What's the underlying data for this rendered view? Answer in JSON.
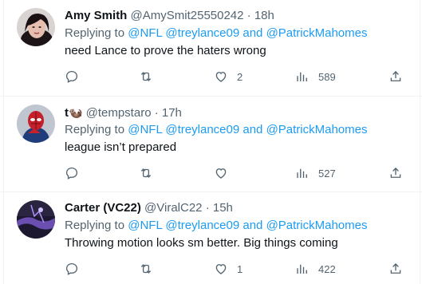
{
  "tweets": [
    {
      "name": "Amy Smith",
      "handle": "@AmySmit25550242",
      "dot": "·",
      "time": "18h",
      "replying_prefix": "Replying to",
      "mention_1": "@NFL",
      "mention_2": "@treylance09",
      "conjunction": "and",
      "mention_3": "@PatrickMahomes",
      "text": "need Lance to prove the haters wrong",
      "likes": "2",
      "views": "589"
    },
    {
      "name": "t",
      "name_emoji": "🦦",
      "handle": "@tempstaro",
      "dot": "·",
      "time": "17h",
      "replying_prefix": "Replying to",
      "mention_1": "@NFL",
      "mention_2": "@treylance09",
      "conjunction": "and",
      "mention_3": "@PatrickMahomes",
      "text": "league isn’t prepared",
      "likes": "",
      "views": "527"
    },
    {
      "name": "Carter (VC22)",
      "handle": "@ViralC22",
      "dot": "·",
      "time": "15h",
      "replying_prefix": "Replying to",
      "mention_1": "@NFL",
      "mention_2": "@treylance09",
      "conjunction": "and",
      "mention_3": "@PatrickMahomes",
      "text": "Throwing motion looks sm better. Big things coming",
      "likes": "1",
      "views": "422"
    }
  ],
  "colors": {
    "accent": "#1d9bf0",
    "secondary_text": "#536471",
    "primary_text": "#0f1419",
    "divider": "#eff3f4"
  },
  "icons": [
    "reply-icon",
    "retweet-icon",
    "like-icon",
    "views-icon",
    "share-icon"
  ]
}
